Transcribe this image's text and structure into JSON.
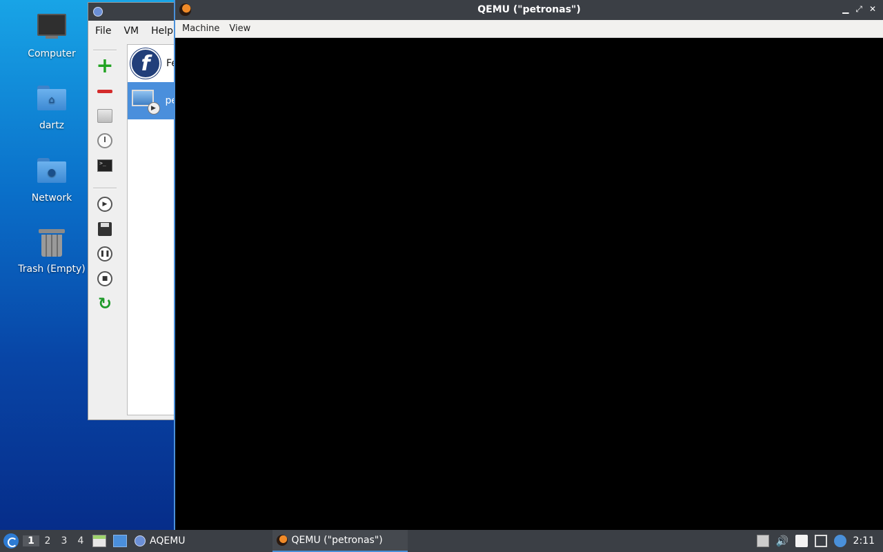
{
  "desktop": {
    "icons": [
      {
        "label": "Computer",
        "icon": "computer-icon"
      },
      {
        "label": "dartz",
        "icon": "home-folder-icon"
      },
      {
        "label": "Network",
        "icon": "network-folder-icon"
      },
      {
        "label": "Trash (Empty)",
        "icon": "trash-icon"
      }
    ]
  },
  "aqemu": {
    "menu": [
      "File",
      "VM",
      "Help"
    ],
    "toolbar": {
      "add_icon": "add-vm-icon",
      "remove_icon": "remove-vm-icon",
      "play_glyph": "▶",
      "pause_glyph": "❚❚",
      "stop_glyph": "■",
      "refresh_glyph": "↻",
      "terminal_glyph": ">_"
    },
    "vm_list": [
      {
        "label": "Fe",
        "icon": "fedora-icon",
        "glyph": "f"
      },
      {
        "label": "pe",
        "icon": "vm-running-icon",
        "selected": true
      }
    ]
  },
  "qemu": {
    "title": "QEMU (\"petronas\")",
    "menu": [
      "Machine",
      "View"
    ],
    "controls": {
      "minimize": "▁",
      "maximize": "⤢",
      "close": "✕"
    }
  },
  "taskbar": {
    "workspaces": [
      "1",
      "2",
      "3",
      "4"
    ],
    "active_workspace": "1",
    "tasks": [
      {
        "label": "AQEMU"
      },
      {
        "label": "QEMU (\"petronas\")"
      }
    ],
    "tray": {
      "volume_glyph": "🔊"
    },
    "clock": "2:11"
  },
  "colors": {
    "accent": "#4a90d9",
    "titlebar": "#3b3f45",
    "selection": "#4a8fdc"
  }
}
